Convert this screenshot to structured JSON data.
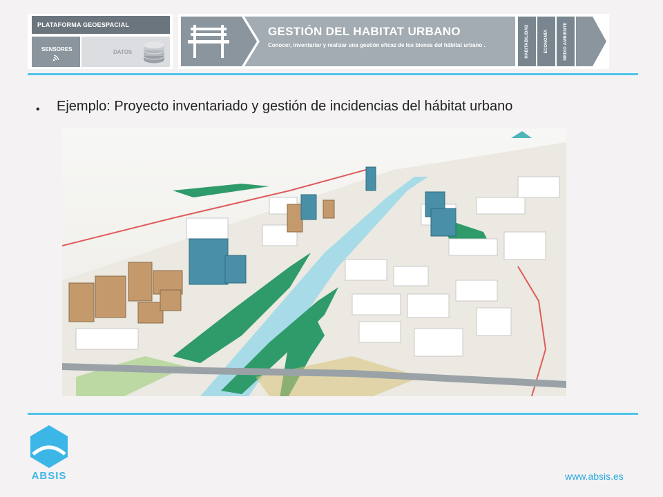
{
  "header": {
    "platform_label": "PLATAFORMA GEOESPACIAL CORPORATIVA",
    "sensors_label": "SENSORES",
    "data_label": "DATOS",
    "banner_title": "GESTIÓN DEL HABITAT URBANO",
    "banner_subtitle": "Conocer, inventariar y realizar una gestión eficaz de los bienes del hábitat urbano .",
    "tabs": [
      "HABITABILIDAD",
      "ECONOMÍA",
      "MEDIO AMBIENTE"
    ],
    "colors": {
      "dark_bar": "#6b757e",
      "banner_grey": "#a3acb3",
      "tab_grey": "#7a868f",
      "accent_rule": "#4fc3ea"
    }
  },
  "content": {
    "bullet": "Ejemplo: Proyecto inventariado y gestión de incidencias del hábitat urbano",
    "image_icon": "urban-3d-render"
  },
  "footer": {
    "logo_text": "ABSIS",
    "website": "www.absis.es",
    "link_color": "#2aa9df"
  }
}
